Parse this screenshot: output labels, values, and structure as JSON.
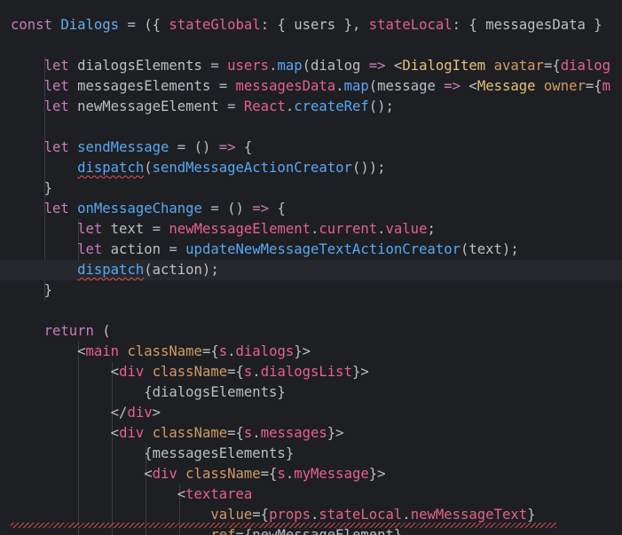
{
  "editor": {
    "theme_colors": {
      "background": "#1e1f22",
      "current_line": "#26282e",
      "error_squiggle": "#e35252"
    },
    "lines": [
      {
        "tokens": [
          [
            "kw2",
            "const"
          ],
          [
            "var",
            " "
          ],
          [
            "cls",
            "Dialogs"
          ],
          [
            "var",
            " "
          ],
          [
            "op",
            "="
          ],
          [
            "var",
            " "
          ],
          [
            "pun",
            "({ "
          ],
          [
            "pnk",
            "stateGlobal"
          ],
          [
            "pun",
            ": { "
          ],
          [
            "var",
            "users"
          ],
          [
            "pun",
            " }, "
          ],
          [
            "pnk",
            "stateLocal"
          ],
          [
            "pun",
            ": { "
          ],
          [
            "var",
            "messagesData"
          ],
          [
            "pun",
            " }"
          ]
        ]
      },
      {
        "tokens": []
      },
      {
        "tokens": [
          [
            "var",
            "    "
          ],
          [
            "kw2",
            "let"
          ],
          [
            "var",
            " dialogsElements "
          ],
          [
            "op",
            "="
          ],
          [
            "var",
            " "
          ],
          [
            "pnk",
            "users"
          ],
          [
            "pun",
            "."
          ],
          [
            "fn",
            "map"
          ],
          [
            "pun",
            "("
          ],
          [
            "var",
            "dialog "
          ],
          [
            "kw2",
            "=>"
          ],
          [
            "var",
            " "
          ],
          [
            "pun",
            "<"
          ],
          [
            "yel",
            "DialogItem"
          ],
          [
            "var",
            " "
          ],
          [
            "ora",
            "avatar"
          ],
          [
            "pun",
            "={"
          ],
          [
            "pnk",
            "dialog"
          ]
        ]
      },
      {
        "tokens": [
          [
            "var",
            "    "
          ],
          [
            "kw2",
            "let"
          ],
          [
            "var",
            " messagesElements "
          ],
          [
            "op",
            "="
          ],
          [
            "var",
            " "
          ],
          [
            "pnk",
            "messagesData"
          ],
          [
            "pun",
            "."
          ],
          [
            "fn",
            "map"
          ],
          [
            "pun",
            "("
          ],
          [
            "var",
            "message "
          ],
          [
            "kw2",
            "=>"
          ],
          [
            "var",
            " "
          ],
          [
            "pun",
            "<"
          ],
          [
            "yel",
            "Message"
          ],
          [
            "var",
            " "
          ],
          [
            "ora",
            "owner"
          ],
          [
            "pun",
            "={"
          ],
          [
            "pnk",
            "m"
          ]
        ]
      },
      {
        "tokens": [
          [
            "var",
            "    "
          ],
          [
            "kw2",
            "let"
          ],
          [
            "var",
            " newMessageElement "
          ],
          [
            "op",
            "="
          ],
          [
            "var",
            " "
          ],
          [
            "pnk",
            "React"
          ],
          [
            "pun",
            "."
          ],
          [
            "fn",
            "createRef"
          ],
          [
            "pun",
            "();"
          ]
        ]
      },
      {
        "tokens": []
      },
      {
        "tokens": [
          [
            "var",
            "    "
          ],
          [
            "kw2",
            "let"
          ],
          [
            "var",
            " "
          ],
          [
            "fn",
            "sendMessage"
          ],
          [
            "var",
            " "
          ],
          [
            "op",
            "="
          ],
          [
            "var",
            " "
          ],
          [
            "pun",
            "() "
          ],
          [
            "kw2",
            "=>"
          ],
          [
            "pun",
            " {"
          ]
        ]
      },
      {
        "tokens": [
          [
            "var",
            "        "
          ],
          [
            "fn squiggle",
            "dispatch"
          ],
          [
            "pun",
            "("
          ],
          [
            "fn",
            "sendMessageActionCreator"
          ],
          [
            "pun",
            "());"
          ]
        ]
      },
      {
        "tokens": [
          [
            "var",
            "    "
          ],
          [
            "pun",
            "}"
          ]
        ]
      },
      {
        "tokens": [
          [
            "var",
            "    "
          ],
          [
            "kw2",
            "let"
          ],
          [
            "var",
            " "
          ],
          [
            "fn",
            "onMessageChange"
          ],
          [
            "var",
            " "
          ],
          [
            "op",
            "="
          ],
          [
            "var",
            " "
          ],
          [
            "pun",
            "() "
          ],
          [
            "kw2",
            "=>"
          ],
          [
            "pun",
            " {"
          ]
        ]
      },
      {
        "tokens": [
          [
            "var",
            "        "
          ],
          [
            "kw2",
            "let"
          ],
          [
            "var",
            " text "
          ],
          [
            "op",
            "="
          ],
          [
            "var",
            " "
          ],
          [
            "pnk",
            "newMessageElement"
          ],
          [
            "pun",
            "."
          ],
          [
            "pnk",
            "current"
          ],
          [
            "pun",
            "."
          ],
          [
            "pnk",
            "value"
          ],
          [
            "pun",
            ";"
          ]
        ]
      },
      {
        "tokens": [
          [
            "var",
            "        "
          ],
          [
            "kw2",
            "let"
          ],
          [
            "var",
            " action "
          ],
          [
            "op",
            "="
          ],
          [
            "var",
            " "
          ],
          [
            "fn",
            "updateNewMessageTextActionCreator"
          ],
          [
            "pun",
            "(text);"
          ]
        ]
      },
      {
        "tokens": [
          [
            "var",
            "        "
          ],
          [
            "fn squiggle",
            "dispatch"
          ],
          [
            "pun",
            "(action);"
          ]
        ],
        "current": true
      },
      {
        "tokens": [
          [
            "var",
            "    "
          ],
          [
            "pun",
            "}"
          ]
        ]
      },
      {
        "tokens": []
      },
      {
        "tokens": [
          [
            "var",
            "    "
          ],
          [
            "kw2",
            "return"
          ],
          [
            "pun",
            " ("
          ]
        ]
      },
      {
        "tokens": [
          [
            "var",
            "        "
          ],
          [
            "pun",
            "<"
          ],
          [
            "pnk",
            "main"
          ],
          [
            "var",
            " "
          ],
          [
            "ora",
            "className"
          ],
          [
            "pun",
            "={"
          ],
          [
            "pnk",
            "s"
          ],
          [
            "pun",
            "."
          ],
          [
            "pnk",
            "dialogs"
          ],
          [
            "pun",
            "}>"
          ]
        ]
      },
      {
        "tokens": [
          [
            "var",
            "            "
          ],
          [
            "pun",
            "<"
          ],
          [
            "pnk",
            "div"
          ],
          [
            "var",
            " "
          ],
          [
            "ora",
            "className"
          ],
          [
            "pun",
            "={"
          ],
          [
            "pnk",
            "s"
          ],
          [
            "pun",
            "."
          ],
          [
            "pnk",
            "dialogsList"
          ],
          [
            "pun",
            "}>"
          ]
        ]
      },
      {
        "tokens": [
          [
            "var",
            "                "
          ],
          [
            "pun",
            "{dialogsElements}"
          ]
        ]
      },
      {
        "tokens": [
          [
            "var",
            "            "
          ],
          [
            "pun",
            "</"
          ],
          [
            "pnk",
            "div"
          ],
          [
            "pun",
            ">"
          ]
        ]
      },
      {
        "tokens": [
          [
            "var",
            "            "
          ],
          [
            "pun",
            "<"
          ],
          [
            "pnk",
            "div"
          ],
          [
            "var",
            " "
          ],
          [
            "ora",
            "className"
          ],
          [
            "pun",
            "={"
          ],
          [
            "pnk",
            "s"
          ],
          [
            "pun",
            "."
          ],
          [
            "pnk",
            "messages"
          ],
          [
            "pun",
            "}>"
          ]
        ]
      },
      {
        "tokens": [
          [
            "var",
            "                "
          ],
          [
            "pun",
            "{messagesElements}"
          ]
        ]
      },
      {
        "tokens": [
          [
            "var",
            "                "
          ],
          [
            "pun",
            "<"
          ],
          [
            "pnk",
            "div"
          ],
          [
            "var",
            " "
          ],
          [
            "ora",
            "className"
          ],
          [
            "pun",
            "={"
          ],
          [
            "pnk",
            "s"
          ],
          [
            "pun",
            "."
          ],
          [
            "pnk",
            "myMessage"
          ],
          [
            "pun",
            "}>"
          ]
        ]
      },
      {
        "tokens": [
          [
            "var",
            "                    "
          ],
          [
            "pun",
            "<"
          ],
          [
            "pnk",
            "textarea"
          ]
        ]
      },
      {
        "tokens": [
          [
            "var",
            "                        "
          ],
          [
            "ora",
            "value"
          ],
          [
            "pun",
            "={"
          ],
          [
            "pnk",
            "props"
          ],
          [
            "pun",
            "."
          ],
          [
            "pnk",
            "stateLocal"
          ],
          [
            "pun",
            "."
          ],
          [
            "pnk",
            "newMessageText"
          ],
          [
            "pun",
            "}"
          ]
        ],
        "error_line": true
      },
      {
        "tokens": [
          [
            "var",
            "                        "
          ],
          [
            "ora",
            "ref"
          ],
          [
            "pun",
            "={"
          ],
          [
            "var",
            "newMessageElement"
          ],
          [
            "pun",
            "}"
          ]
        ]
      }
    ]
  }
}
